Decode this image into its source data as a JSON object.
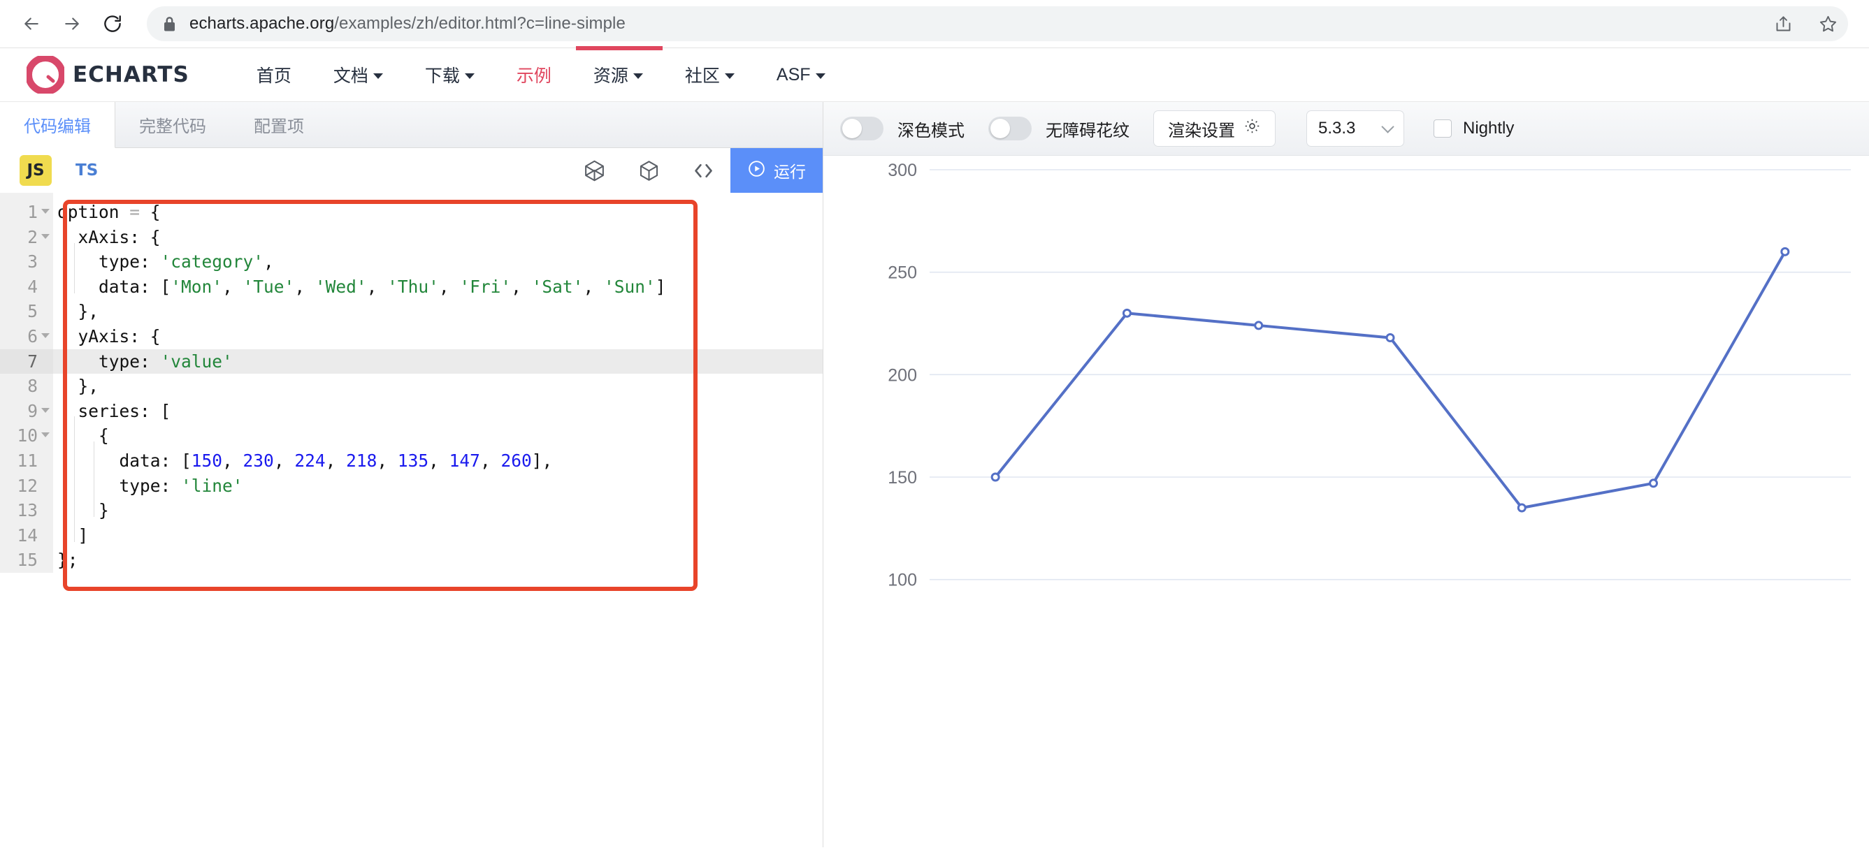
{
  "browser": {
    "back_icon": "back-arrow-icon",
    "forward_icon": "forward-arrow-icon",
    "reload_icon": "reload-icon",
    "lock_icon": "lock-icon",
    "url_domain": "echarts.apache.org",
    "url_path": "/examples/zh/editor.html?c=line-simple",
    "share_icon": "share-icon",
    "bookmark_icon": "star-icon"
  },
  "site": {
    "brand_name": "ECHARTS",
    "logo_icon": "echarts-logo-icon",
    "accent_color": "#e0465e",
    "nav": [
      {
        "label": "首页",
        "has_caret": false,
        "active": false
      },
      {
        "label": "文档",
        "has_caret": true,
        "active": false
      },
      {
        "label": "下载",
        "has_caret": true,
        "active": false
      },
      {
        "label": "示例",
        "has_caret": false,
        "active": true
      },
      {
        "label": "资源",
        "has_caret": true,
        "active": false
      },
      {
        "label": "社区",
        "has_caret": true,
        "active": false
      },
      {
        "label": "ASF",
        "has_caret": true,
        "active": false
      }
    ]
  },
  "editor": {
    "tabs": [
      {
        "label": "代码编辑",
        "active": true
      },
      {
        "label": "完整代码",
        "active": false
      },
      {
        "label": "配置项",
        "active": false
      }
    ],
    "lang_js": "JS",
    "lang_ts": "TS",
    "toolbar_icons": [
      "gem-icon",
      "cube-icon",
      "code-brackets-icon"
    ],
    "run_label": "运行",
    "run_icon": "play-circle-icon",
    "run_button_color": "#5b8ff9",
    "active_line": 7,
    "annotation_color": "#e8442a",
    "lines": [
      {
        "n": 1,
        "fold": true,
        "text": "option = {"
      },
      {
        "n": 2,
        "fold": true,
        "text": "  xAxis: {"
      },
      {
        "n": 3,
        "fold": false,
        "text": "    type: 'category',"
      },
      {
        "n": 4,
        "fold": false,
        "text": "    data: ['Mon', 'Tue', 'Wed', 'Thu', 'Fri', 'Sat', 'Sun']"
      },
      {
        "n": 5,
        "fold": false,
        "text": "  },"
      },
      {
        "n": 6,
        "fold": true,
        "text": "  yAxis: {"
      },
      {
        "n": 7,
        "fold": false,
        "text": "    type: 'value'"
      },
      {
        "n": 8,
        "fold": false,
        "text": "  },"
      },
      {
        "n": 9,
        "fold": true,
        "text": "  series: ["
      },
      {
        "n": 10,
        "fold": true,
        "text": "    {"
      },
      {
        "n": 11,
        "fold": false,
        "text": "      data: [150, 230, 224, 218, 135, 147, 260],"
      },
      {
        "n": 12,
        "fold": false,
        "text": "      type: 'line'"
      },
      {
        "n": 13,
        "fold": false,
        "text": "    }"
      },
      {
        "n": 14,
        "fold": false,
        "text": "  ]"
      },
      {
        "n": 15,
        "fold": false,
        "text": "};"
      }
    ]
  },
  "preview": {
    "dark_mode_label": "深色模式",
    "dark_mode_on": false,
    "pattern_label": "无障碍花纹",
    "pattern_on": false,
    "render_settings_label": "渲染设置",
    "render_settings_icon": "gear-icon",
    "version": "5.3.3",
    "version_caret_icon": "chevron-down-icon",
    "nightly_label": "Nightly",
    "nightly_checked": false
  },
  "chart_data": {
    "type": "line",
    "title": "",
    "xlabel": "",
    "ylabel": "",
    "categories": [
      "Mon",
      "Tue",
      "Wed",
      "Thu",
      "Fri",
      "Sat",
      "Sun"
    ],
    "values": [
      150,
      230,
      224,
      218,
      135,
      147,
      260
    ],
    "series": [
      {
        "name": "",
        "values": [
          150,
          230,
          224,
          218,
          135,
          147,
          260
        ]
      }
    ],
    "ylim": [
      0,
      300
    ],
    "yticks": [
      100,
      150,
      200,
      250,
      300
    ],
    "ytick_labels": [
      "100",
      "150",
      "200",
      "250",
      "300"
    ],
    "grid": true,
    "legend": "none",
    "line_color": "#5470c6",
    "symbol": "emptyCircle",
    "axis_label_color": "#6e7079"
  }
}
